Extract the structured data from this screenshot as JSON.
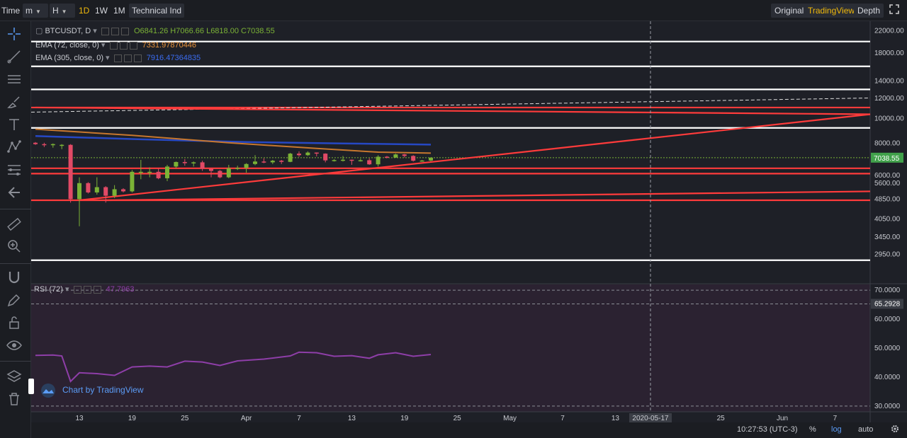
{
  "toolbar": {
    "time_label": "Time",
    "minute_select": "m",
    "hour_select": "H",
    "intervals": [
      "1D",
      "1W",
      "1M"
    ],
    "active_interval": "1D",
    "indicators_label": "Technical Ind",
    "views": [
      "Original",
      "TradingView",
      "Depth"
    ],
    "active_view": "TradingView"
  },
  "sidebar": {
    "tools": [
      "crosshair-icon",
      "trendline-icon",
      "horizontal-lines-icon",
      "brush-icon",
      "text-icon",
      "pattern-icon",
      "fib-icon",
      "back-arrow-icon",
      "ruler-icon",
      "zoom-icon",
      "magnet-icon",
      "pencil-lock-icon",
      "lock-icon",
      "eye-icon",
      "layers-icon",
      "trash-icon"
    ]
  },
  "legend": {
    "symbol": "BTCUSDT, D",
    "ohlc": "O6841.26 H7066.66 L6818.00 C7038.55",
    "ema72_label": "EMA (72, close, 0)",
    "ema72_value": "7331.97870446",
    "ema305_label": "EMA (305, close, 0)",
    "ema305_value": "7916.47364835",
    "rsi_label": "RSI (72)",
    "rsi_value": "47.7963"
  },
  "watermark": "Chart by TradingView",
  "bottom": {
    "clock": "10:27:53 (UTC-3)",
    "percent": "%",
    "log": "log",
    "auto": "auto"
  },
  "colors": {
    "up": "#7bb236",
    "down": "#e14a66",
    "ema72": "#c7772e",
    "ema305": "#2648c4",
    "rsi": "#8e3ea8",
    "hline_red": "#ff3b3b",
    "hline_white": "#ffffff",
    "accent": "#f0b90b",
    "price_label_bg": "#41a14b"
  },
  "chart_data": [
    {
      "type": "candlestick",
      "title": "BTCUSDT, D",
      "y_scale": "log",
      "y_ticks": [
        22000.0,
        18000.0,
        14000.0,
        12000.0,
        10000.0,
        8000.0,
        6000.0,
        5600.0,
        4850.0,
        4050.0,
        3450.0,
        2950.0
      ],
      "y_tick_labels": [
        "22000.00",
        "18000.00",
        "14000.00",
        "12000.00",
        "10000.00",
        "8000.00",
        "6000.00",
        "5600.00",
        "4850.00",
        "4050.00",
        "3450.00",
        "2950.00"
      ],
      "x_tick_labels": [
        "13",
        "19",
        "25",
        "Apr",
        "7",
        "13",
        "19",
        "25",
        "May",
        "7",
        "13",
        "2020-05-17",
        "25",
        "Jun",
        "7"
      ],
      "x_tick_dates": [
        "2020-03-13",
        "2020-03-19",
        "2020-03-25",
        "2020-04-01",
        "2020-04-07",
        "2020-04-13",
        "2020-04-19",
        "2020-04-25",
        "2020-05-01",
        "2020-05-07",
        "2020-05-13",
        "2020-05-17",
        "2020-05-25",
        "2020-06-01",
        "2020-06-07"
      ],
      "x_range": [
        "2020-03-08",
        "2020-06-11"
      ],
      "ylim": [
        2400,
        24000
      ],
      "crosshair_date": "2020-05-17",
      "last_price": "7038.55",
      "candles": [
        {
          "date": "2020-03-08",
          "o": 8050,
          "h": 8100,
          "l": 7900,
          "c": 7950
        },
        {
          "date": "2020-03-09",
          "o": 7950,
          "h": 8050,
          "l": 7750,
          "c": 7900
        },
        {
          "date": "2020-03-10",
          "o": 7900,
          "h": 8000,
          "l": 7700,
          "c": 7950
        },
        {
          "date": "2020-03-11",
          "o": 7900,
          "h": 7950,
          "l": 7600,
          "c": 7900
        },
        {
          "date": "2020-03-12",
          "o": 7900,
          "h": 7950,
          "l": 4700,
          "c": 4850
        },
        {
          "date": "2020-03-13",
          "o": 4850,
          "h": 5900,
          "l": 3800,
          "c": 5600
        },
        {
          "date": "2020-03-14",
          "o": 5600,
          "h": 5650,
          "l": 5100,
          "c": 5150
        },
        {
          "date": "2020-03-15",
          "o": 5150,
          "h": 5900,
          "l": 5050,
          "c": 5400
        },
        {
          "date": "2020-03-16",
          "o": 5400,
          "h": 5450,
          "l": 4700,
          "c": 5000
        },
        {
          "date": "2020-03-17",
          "o": 5000,
          "h": 5500,
          "l": 4900,
          "c": 5300
        },
        {
          "date": "2020-03-18",
          "o": 5300,
          "h": 5350,
          "l": 5150,
          "c": 5200
        },
        {
          "date": "2020-03-19",
          "o": 5200,
          "h": 6300,
          "l": 5150,
          "c": 6200
        },
        {
          "date": "2020-03-20",
          "o": 6200,
          "h": 6900,
          "l": 5800,
          "c": 6200
        },
        {
          "date": "2020-03-21",
          "o": 6200,
          "h": 6450,
          "l": 5900,
          "c": 6200
        },
        {
          "date": "2020-03-22",
          "o": 6200,
          "h": 6400,
          "l": 5800,
          "c": 5850
        },
        {
          "date": "2020-03-23",
          "o": 5850,
          "h": 6600,
          "l": 5700,
          "c": 6500
        },
        {
          "date": "2020-03-24",
          "o": 6500,
          "h": 6800,
          "l": 6400,
          "c": 6770
        },
        {
          "date": "2020-03-25",
          "o": 6770,
          "h": 6950,
          "l": 6550,
          "c": 6700
        },
        {
          "date": "2020-03-26",
          "o": 6700,
          "h": 6800,
          "l": 6500,
          "c": 6750
        },
        {
          "date": "2020-03-27",
          "o": 6750,
          "h": 6850,
          "l": 6250,
          "c": 6370
        },
        {
          "date": "2020-03-28",
          "o": 6370,
          "h": 6400,
          "l": 5900,
          "c": 6250
        },
        {
          "date": "2020-03-29",
          "o": 6250,
          "h": 6300,
          "l": 5850,
          "c": 5900
        },
        {
          "date": "2020-03-30",
          "o": 5900,
          "h": 6600,
          "l": 5850,
          "c": 6400
        },
        {
          "date": "2020-03-31",
          "o": 6400,
          "h": 6550,
          "l": 6300,
          "c": 6420
        },
        {
          "date": "2020-04-01",
          "o": 6420,
          "h": 6700,
          "l": 6150,
          "c": 6650
        },
        {
          "date": "2020-04-02",
          "o": 6650,
          "h": 7200,
          "l": 6580,
          "c": 6800
        },
        {
          "date": "2020-04-03",
          "o": 6800,
          "h": 7000,
          "l": 6700,
          "c": 6750
        },
        {
          "date": "2020-04-04",
          "o": 6750,
          "h": 6900,
          "l": 6650,
          "c": 6850
        },
        {
          "date": "2020-04-05",
          "o": 6850,
          "h": 6900,
          "l": 6650,
          "c": 6780
        },
        {
          "date": "2020-04-06",
          "o": 6780,
          "h": 7350,
          "l": 6760,
          "c": 7300
        },
        {
          "date": "2020-04-07",
          "o": 7300,
          "h": 7450,
          "l": 7100,
          "c": 7200
        },
        {
          "date": "2020-04-08",
          "o": 7200,
          "h": 7450,
          "l": 7150,
          "c": 7370
        },
        {
          "date": "2020-04-09",
          "o": 7370,
          "h": 7380,
          "l": 7120,
          "c": 7300
        },
        {
          "date": "2020-04-10",
          "o": 7300,
          "h": 7320,
          "l": 6750,
          "c": 6870
        },
        {
          "date": "2020-04-11",
          "o": 6870,
          "h": 6950,
          "l": 6800,
          "c": 6890
        },
        {
          "date": "2020-04-12",
          "o": 6890,
          "h": 7150,
          "l": 6800,
          "c": 6910
        },
        {
          "date": "2020-04-13",
          "o": 6910,
          "h": 6920,
          "l": 6600,
          "c": 6860
        },
        {
          "date": "2020-04-14",
          "o": 6860,
          "h": 6980,
          "l": 6800,
          "c": 6880
        },
        {
          "date": "2020-04-15",
          "o": 6880,
          "h": 7000,
          "l": 6600,
          "c": 6630
        },
        {
          "date": "2020-04-16",
          "o": 6630,
          "h": 7200,
          "l": 6500,
          "c": 7100
        },
        {
          "date": "2020-04-17",
          "o": 7100,
          "h": 7150,
          "l": 7000,
          "c": 7050
        },
        {
          "date": "2020-04-18",
          "o": 7050,
          "h": 7300,
          "l": 7030,
          "c": 7250
        },
        {
          "date": "2020-04-19",
          "o": 7250,
          "h": 7280,
          "l": 7050,
          "c": 7150
        },
        {
          "date": "2020-04-20",
          "o": 7150,
          "h": 7200,
          "l": 6800,
          "c": 6850
        },
        {
          "date": "2020-04-21",
          "o": 6850,
          "h": 6900,
          "l": 6800,
          "c": 6860
        },
        {
          "date": "2020-04-22",
          "o": 6860,
          "h": 7066.66,
          "l": 6818,
          "c": 7038.55
        }
      ],
      "ema72": [
        {
          "date": "2020-03-08",
          "v": 9100
        },
        {
          "date": "2020-03-19",
          "v": 8600
        },
        {
          "date": "2020-03-30",
          "v": 8050
        },
        {
          "date": "2020-04-09",
          "v": 7650
        },
        {
          "date": "2020-04-16",
          "v": 7400
        },
        {
          "date": "2020-04-22",
          "v": 7331.98
        }
      ],
      "ema305": [
        {
          "date": "2020-03-08",
          "v": 8550
        },
        {
          "date": "2020-03-20",
          "v": 8300
        },
        {
          "date": "2020-04-01",
          "v": 8100
        },
        {
          "date": "2020-04-12",
          "v": 8000
        },
        {
          "date": "2020-04-22",
          "v": 7916.47
        }
      ],
      "hlines_white": [
        20000,
        16000,
        13000,
        9200,
        2800
      ],
      "hlines_red": [
        11050,
        6400,
        6100,
        4800
      ],
      "hlines_dashed": [
        10600,
        7038.55
      ],
      "trendlines_red": [
        {
          "from": {
            "date": "2020-03-08",
            "v": 11050
          },
          "to": {
            "date": "2020-06-11",
            "v": 10400
          }
        },
        {
          "from": {
            "date": "2020-03-13",
            "v": 4800
          },
          "to": {
            "date": "2020-06-11",
            "v": 10400
          }
        },
        {
          "from": {
            "date": "2020-03-16",
            "v": 4800
          },
          "to": {
            "date": "2020-06-11",
            "v": 5200
          }
        }
      ]
    },
    {
      "type": "line",
      "title": "RSI (72)",
      "ylim": [
        28,
        72
      ],
      "y_tick_labels": [
        "70.0000",
        "65.2928",
        "60.0000",
        "50.0000",
        "40.0000",
        "30.0000"
      ],
      "y_ticks": [
        70,
        65.2928,
        60,
        50,
        40,
        30
      ],
      "dashed_levels": [
        70,
        65.2928,
        30
      ],
      "series": [
        {
          "date": "2020-03-08",
          "v": 47.5
        },
        {
          "date": "2020-03-10",
          "v": 47.6
        },
        {
          "date": "2020-03-11",
          "v": 47.3
        },
        {
          "date": "2020-03-12",
          "v": 38.5
        },
        {
          "date": "2020-03-13",
          "v": 41.5
        },
        {
          "date": "2020-03-15",
          "v": 41.2
        },
        {
          "date": "2020-03-17",
          "v": 40.6
        },
        {
          "date": "2020-03-19",
          "v": 43.5
        },
        {
          "date": "2020-03-21",
          "v": 43.8
        },
        {
          "date": "2020-03-23",
          "v": 43.5
        },
        {
          "date": "2020-03-25",
          "v": 45.5
        },
        {
          "date": "2020-03-27",
          "v": 45.2
        },
        {
          "date": "2020-03-29",
          "v": 44.0
        },
        {
          "date": "2020-03-31",
          "v": 45.6
        },
        {
          "date": "2020-04-03",
          "v": 46.2
        },
        {
          "date": "2020-04-06",
          "v": 47.3
        },
        {
          "date": "2020-04-07",
          "v": 48.6
        },
        {
          "date": "2020-04-09",
          "v": 48.4
        },
        {
          "date": "2020-04-11",
          "v": 47.2
        },
        {
          "date": "2020-04-13",
          "v": 47.4
        },
        {
          "date": "2020-04-15",
          "v": 46.5
        },
        {
          "date": "2020-04-16",
          "v": 47.7
        },
        {
          "date": "2020-04-18",
          "v": 48.4
        },
        {
          "date": "2020-04-20",
          "v": 47.2
        },
        {
          "date": "2020-04-22",
          "v": 47.8
        }
      ]
    }
  ]
}
